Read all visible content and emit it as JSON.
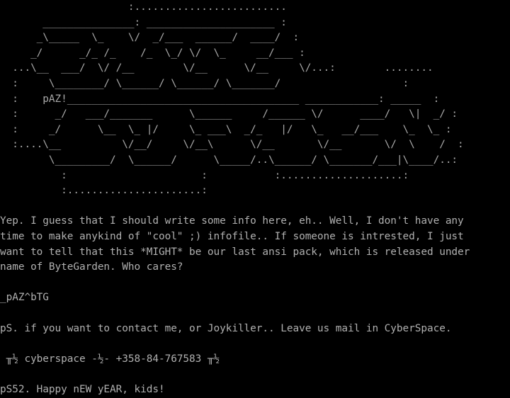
{
  "screen": {
    "foreground": "#aaaaaa",
    "background": "#000000"
  },
  "logo": {
    "lines": [
      "                     :.........................",
      "       _______________: _____________________ :",
      "      _\\_____  \\_    \\/  _/___  ______/  ____/  :",
      "     _/      _/_ /_    /_  \\_/ \\/  \\_     __/___ :",
      "  ...\\__  ___/  \\/ /__        \\/__      \\/__     \\/...:        ........",
      "  :     \\________/ \\______/ \\______/ \\_______/                    :",
      "  :    pAZ!______________________________________ ____________: _____  :",
      "  :      _/   ___/_______      \\______     /______ \\/      ____/   \\|  _/ :",
      "  :     _/      \\__  \\_ |/     \\_ ___\\  _/_   |/   \\_   __/___    \\_  \\_ :",
      "  :....\\__          \\/__/     \\/__\\      \\/__       \\/__       \\/  \\    /  :",
      "        \\_________/  \\______/      \\_____/..\\______/ \\_______/___|\\____/..:",
      "          :                      :           :....................:",
      "          :......................:"
    ]
  },
  "info": {
    "paragraph_lines": [
      "Yep. I guess that I should write some info here, eh.. Well, I don't have any",
      "time to make anykind of \"cool\" ;) infofile.. If someone is intrested, I just",
      "want to tell that this *MIGHT* be our last ansi pack, which is released under",
      "name of ByteGarden. Who cares?"
    ],
    "signature": "_pAZ^bTG",
    "contact": "pS. if you want to contact me, or Joykiller.. Leave us mail in CyberSpace.",
    "bbs": " ╥½ cyberspace -½- +358-84-767583 ╥½",
    "ps2": "pS52. Happy nEW yEAR, kids!"
  }
}
